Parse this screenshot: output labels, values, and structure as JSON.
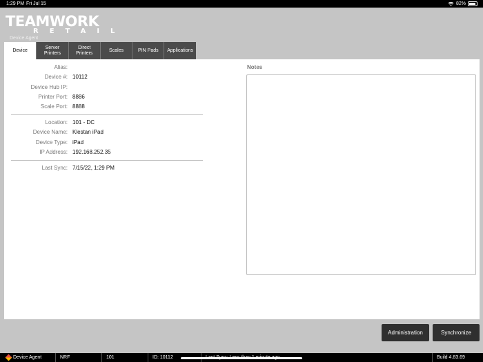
{
  "status_bar": {
    "time": "1:29 PM",
    "date": "Fri Jul 15",
    "battery": "82%"
  },
  "logo": {
    "main": "TEAMWORK",
    "sub_word": "RETAIL",
    "subtitle": "Device Agent"
  },
  "tabs": [
    {
      "label": "Device",
      "active": true
    },
    {
      "label": "Server\nPrinters"
    },
    {
      "label": "Direct\nPrinters"
    },
    {
      "label": "Scales"
    },
    {
      "label": "PIN Pads"
    },
    {
      "label": "Applications"
    }
  ],
  "device": {
    "alias": {
      "label": "Alias:",
      "value": ""
    },
    "device_no": {
      "label": "Device #:",
      "value": "10112"
    },
    "device_hub_ip": {
      "label": "Device Hub IP:",
      "value": ""
    },
    "printer_port": {
      "label": "Printer Port:",
      "value": "8886"
    },
    "scale_port": {
      "label": "Scale Port:",
      "value": "8888"
    },
    "location": {
      "label": "Location:",
      "value": "101 - DC"
    },
    "device_name": {
      "label": "Device Name:",
      "value": "Klestan iPad"
    },
    "device_type": {
      "label": "Device Type:",
      "value": "iPad"
    },
    "ip_address": {
      "label": "IP Address:",
      "value": "192.168.252.35"
    },
    "last_sync": {
      "label": "Last Sync:",
      "value": "7/15/22, 1:29 PM"
    }
  },
  "notes": {
    "label": "Notes",
    "value": ""
  },
  "buttons": {
    "administration": "Administration",
    "synchronize": "Synchronize"
  },
  "bottom_bar": {
    "app": "Device Agent",
    "company": "NRF",
    "location": "101",
    "id": "ID: 10112",
    "sync": "Last Sync: Less than 1 minute ago",
    "build": "Build 4.83.69"
  },
  "colors": {
    "background": "#c5c5c5",
    "tab_dark": "#4b4b4b",
    "button_dark": "#2f2f2f"
  }
}
